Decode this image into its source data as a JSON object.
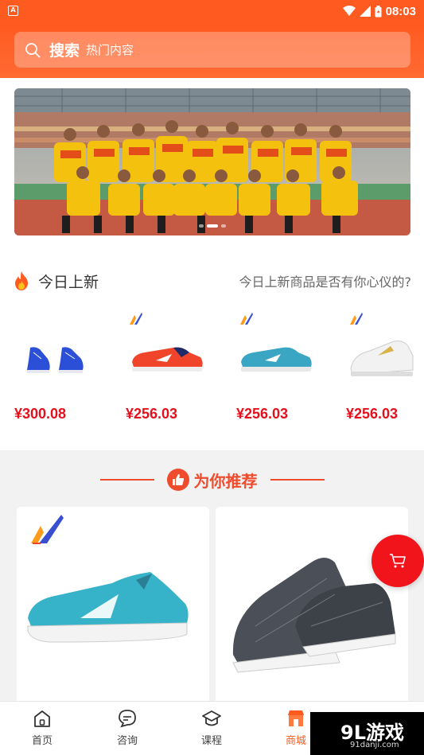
{
  "status_bar": {
    "time": "08:03",
    "app_icon_letter": "A"
  },
  "search": {
    "title": "搜索",
    "hint": "热门内容",
    "icon": "search-icon"
  },
  "banner": {
    "slides": 3,
    "active_slide": 1
  },
  "new_today": {
    "title": "今日上新",
    "subtitle": "今日上新商品是否有你心仪的?",
    "products": [
      {
        "price": "¥300.08",
        "color": "#2b4fd6"
      },
      {
        "price": "¥256.03",
        "color": "#f0452a"
      },
      {
        "price": "¥256.03",
        "color": "#3aa6c4"
      },
      {
        "price": "¥256.03",
        "color": "#f2f2f2"
      }
    ]
  },
  "recommend": {
    "title": "为你推荐"
  },
  "bottom_nav": [
    {
      "label": "首页",
      "icon": "home-icon"
    },
    {
      "label": "咨询",
      "icon": "chat-icon"
    },
    {
      "label": "课程",
      "icon": "graduation-cap-icon"
    },
    {
      "label": "商城",
      "icon": "shop-icon"
    }
  ],
  "watermark": {
    "main": "9L游戏",
    "sub": "91danji.com"
  },
  "colors": {
    "brand": "#ff5a1f",
    "price": "#e4101c",
    "accent": "#ef4b2d"
  }
}
